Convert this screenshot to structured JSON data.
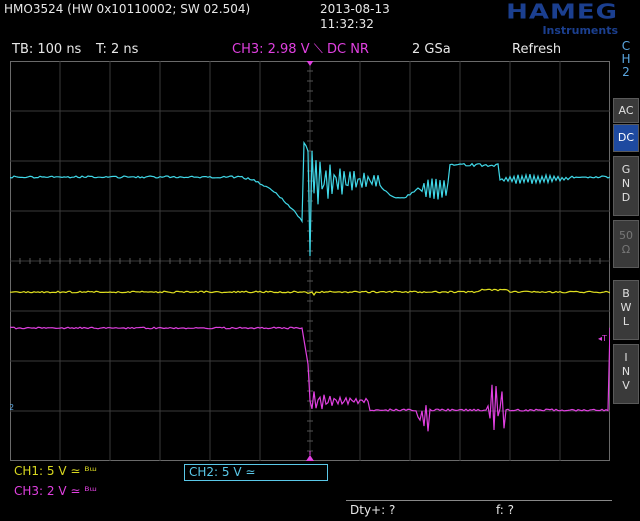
{
  "header": {
    "model": "HMO3524 (HW 0x10110002; SW 02.504)",
    "date": "2013-08-13",
    "time": "11:32:32",
    "logo_main": "HAMEG",
    "logo_sub": "Instruments"
  },
  "status": {
    "timebase": "TB: 100 ns",
    "trigger_time": "T: 2 ns",
    "trigger": "CH3: 2.98 V ⟍ DC NR",
    "sample_rate": "2 GSa",
    "mode": "Refresh"
  },
  "side_panel": {
    "channel": [
      "C",
      "H",
      "2"
    ],
    "buttons": [
      {
        "label": "AC",
        "active": false
      },
      {
        "label": "DC",
        "active": true
      },
      {
        "label": "G N D",
        "active": false
      },
      {
        "label": "50 Ω",
        "active": false,
        "dim": true
      },
      {
        "label": "B W L",
        "active": false
      },
      {
        "label": "I N V",
        "active": false
      }
    ]
  },
  "channels": {
    "ch1": "CH1: 5 V ≃ ᴮᵚ",
    "ch2": "CH2: 5 V ≃",
    "ch3": "CH3: 2 V ≃ ᴮᵚ"
  },
  "measurements": {
    "m1": "Dty+: ?",
    "m2": "f: ?"
  },
  "colors": {
    "ch1": "#e0e020",
    "ch2": "#40d8e8",
    "ch3": "#e040e0",
    "grid": "#3a3a3a",
    "logo": "#1b3f8f"
  },
  "markers": {
    "left_ch_label": "2",
    "trigger_label": "T"
  }
}
